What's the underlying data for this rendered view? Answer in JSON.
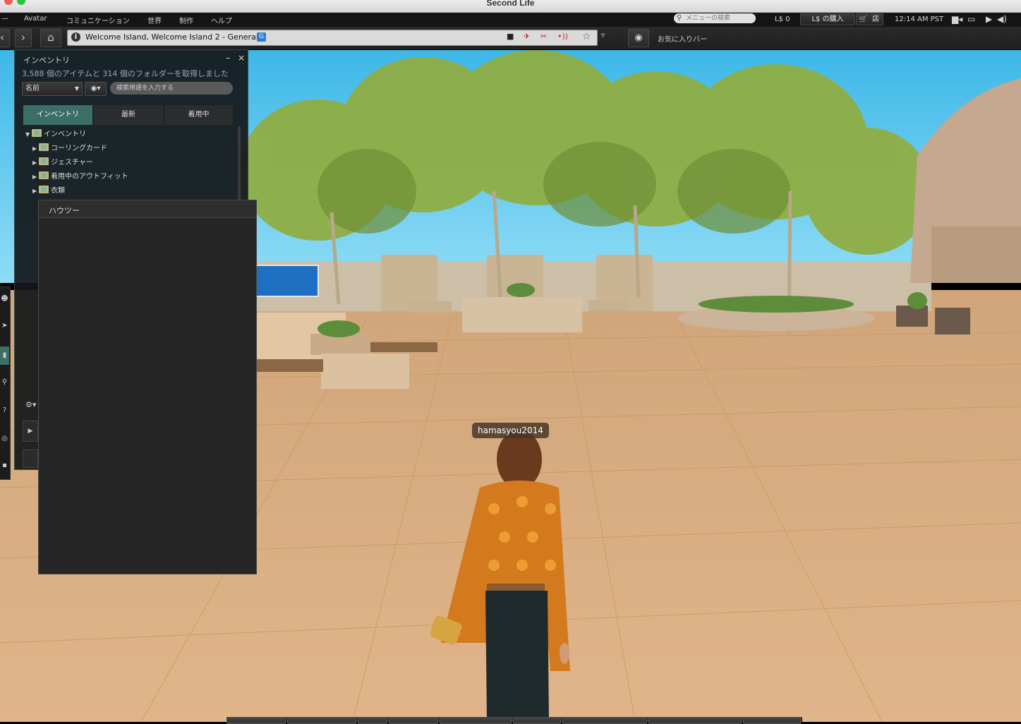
{
  "window": {
    "title": "Second Life"
  },
  "menubar": {
    "items": [
      "Avatar",
      "コミュニケーション",
      "世界",
      "制作",
      "ヘルプ"
    ],
    "search_placeholder": "メニューの検索",
    "balance": "L$ 0",
    "buy_label": "L$ の購入",
    "shop_label": "店",
    "time": "12:14 AM PST"
  },
  "navbar": {
    "location": "Welcome Island, Welcome Island 2 - General",
    "maturity": "G",
    "favorites_label": "お気に入りバー"
  },
  "inventory": {
    "title": "インベントリ",
    "count_text": "3,588 個のアイテムと 314 個のフォルダーを取得しました",
    "sort_value": "名前",
    "search_placeholder": "検索用語を入力する",
    "tabs": [
      "インベントリ",
      "最新",
      "着用中"
    ],
    "tree": [
      {
        "label": "インベントリ",
        "level": 0,
        "expanded": true
      },
      {
        "label": "コーリングカード",
        "level": 1
      },
      {
        "label": "ジェスチャー",
        "level": 1
      },
      {
        "label": "着用中のアウトフィット",
        "level": 1
      },
      {
        "label": "衣類",
        "level": 1
      }
    ]
  },
  "houzoo": {
    "title": "ハウツー"
  },
  "scene": {
    "avatar_name": "hamasyou2014"
  },
  "colors": {
    "accent_teal": "#3b6e66",
    "sky": "#56c9ee",
    "ground": "#d9ae80"
  }
}
